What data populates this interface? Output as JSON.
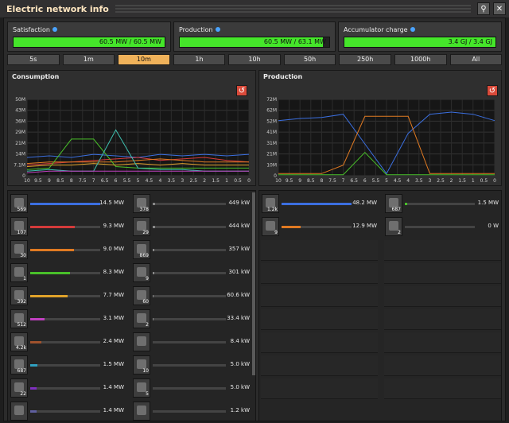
{
  "window": {
    "title": "Electric network info"
  },
  "stats": [
    {
      "label": "Satisfaction",
      "text": "60.5 MW / 60.5 MW",
      "fraction": 1.0
    },
    {
      "label": "Production",
      "text": "60.5 MW / 63.1 MW",
      "fraction": 0.96
    },
    {
      "label": "Accumulator charge",
      "text": "3.4 GJ / 3.4 GJ",
      "fraction": 1.0
    }
  ],
  "tabs": [
    "5s",
    "1m",
    "10m",
    "1h",
    "10h",
    "50h",
    "250h",
    "1000h",
    "All"
  ],
  "active_tab": "10m",
  "consumption": {
    "title": "Consumption",
    "y_ticks": [
      "50M",
      "43M",
      "36M",
      "29M",
      "21M",
      "14M",
      "7.1M",
      "0"
    ],
    "x_ticks": [
      "10",
      "9.5",
      "9",
      "8.5",
      "8",
      "7.5",
      "7",
      "6.5",
      "6",
      "5.5",
      "5",
      "4.5",
      "4",
      "3.5",
      "3",
      "2.5",
      "2",
      "1.5",
      "1",
      "0.5",
      "0"
    ]
  },
  "production": {
    "title": "Production",
    "y_ticks": [
      "72M",
      "62M",
      "52M",
      "41M",
      "31M",
      "21M",
      "10M",
      "0"
    ],
    "x_ticks": [
      "10",
      "9.5",
      "9",
      "8.5",
      "8",
      "7.5",
      "7",
      "6.5",
      "6",
      "5.5",
      "5",
      "4.5",
      "4",
      "3.5",
      "3",
      "2.5",
      "2",
      "1.5",
      "1",
      "0.5",
      "0"
    ]
  },
  "chart_data": [
    {
      "type": "line",
      "title": "Consumption",
      "ylim": [
        0,
        50
      ],
      "yunit": "MW",
      "x": [
        10,
        9,
        8,
        7,
        6,
        5,
        4,
        3,
        2,
        1,
        0
      ],
      "series": [
        {
          "color": "#3b6fe0",
          "values": [
            12,
            13,
            12,
            14,
            13,
            12,
            14,
            13,
            14,
            13,
            14
          ]
        },
        {
          "color": "#d43a3a",
          "values": [
            7,
            8,
            9,
            10,
            11,
            12,
            10,
            11,
            12,
            10,
            9
          ]
        },
        {
          "color": "#e07a22",
          "values": [
            8,
            9,
            9,
            9,
            9,
            10,
            11,
            10,
            9,
            9,
            9
          ]
        },
        {
          "color": "#49c02a",
          "values": [
            4,
            5,
            24,
            24,
            6,
            5,
            5,
            5,
            5,
            5,
            5
          ]
        },
        {
          "color": "#e0a22a",
          "values": [
            6,
            7,
            7,
            8,
            7,
            8,
            7,
            8,
            7,
            7,
            7
          ]
        },
        {
          "color": "#3fc0b0",
          "values": [
            3,
            4,
            3,
            3,
            30,
            5,
            4,
            4,
            3,
            3,
            3
          ]
        },
        {
          "color": "#c040c0",
          "values": [
            2,
            3,
            3,
            3,
            3,
            3,
            3,
            3,
            3,
            3,
            3
          ]
        }
      ]
    },
    {
      "type": "line",
      "title": "Production",
      "ylim": [
        0,
        72
      ],
      "yunit": "MW",
      "x": [
        10,
        9,
        8,
        7,
        6,
        5,
        4,
        3,
        2,
        1,
        0
      ],
      "series": [
        {
          "color": "#3b6fe0",
          "values": [
            52,
            54,
            55,
            58,
            30,
            2,
            40,
            58,
            60,
            58,
            52
          ]
        },
        {
          "color": "#e07a22",
          "values": [
            2,
            2,
            2,
            10,
            56,
            56,
            56,
            2,
            2,
            2,
            2
          ]
        },
        {
          "color": "#49c02a",
          "values": [
            1,
            1,
            1,
            1,
            22,
            1,
            1,
            1,
            1,
            1,
            1
          ]
        }
      ]
    }
  ],
  "consumers_left": [
    {
      "icon": "lab-icon",
      "count": "569",
      "value": "14.5 MW",
      "fraction": 1.0,
      "color": "#3b6fe0"
    },
    {
      "icon": "assembler-icon",
      "count": "107",
      "value": "9.3 MW",
      "fraction": 0.64,
      "color": "#d43a3a"
    },
    {
      "icon": "drill-icon",
      "count": "30",
      "value": "9.0 MW",
      "fraction": 0.62,
      "color": "#e07a22"
    },
    {
      "icon": "beacon-icon",
      "count": "1",
      "value": "8.3 MW",
      "fraction": 0.57,
      "color": "#49c02a"
    },
    {
      "icon": "furnace-icon",
      "count": "392",
      "value": "7.7 MW",
      "fraction": 0.53,
      "color": "#e0a22a"
    },
    {
      "icon": "inserter-icon",
      "count": "512",
      "value": "3.1 MW",
      "fraction": 0.21,
      "color": "#c040c0"
    },
    {
      "icon": "turret-icon",
      "count": "4.2k",
      "value": "2.4 MW",
      "fraction": 0.16,
      "color": "#a0522d"
    },
    {
      "icon": "radar-icon",
      "count": "687",
      "value": "1.5 MW",
      "fraction": 0.1,
      "color": "#30a0c0"
    },
    {
      "icon": "pump-icon",
      "count": "22",
      "value": "1.4 MW",
      "fraction": 0.09,
      "color": "#8030c0"
    },
    {
      "icon": "machine-icon",
      "count": "",
      "value": "1.4 MW",
      "fraction": 0.09,
      "color": "#6060a0"
    }
  ],
  "consumers_right": [
    {
      "icon": "centrifuge-icon",
      "count": "378",
      "value": "449 kW",
      "fraction": 0.03,
      "color": "#888888"
    },
    {
      "icon": "chemical-plant-icon",
      "count": "29",
      "value": "444 kW",
      "fraction": 0.03,
      "color": "#888888"
    },
    {
      "icon": "refinery-icon",
      "count": "869",
      "value": "357 kW",
      "fraction": 0.02,
      "color": "#888888"
    },
    {
      "icon": "rocket-silo-icon",
      "count": "9",
      "value": "301 kW",
      "fraction": 0.02,
      "color": "#888888"
    },
    {
      "icon": "splitter-icon",
      "count": "60",
      "value": "60.6 kW",
      "fraction": 0.01,
      "color": "#888888"
    },
    {
      "icon": "roboport-icon",
      "count": "2",
      "value": "33.4 kW",
      "fraction": 0.01,
      "color": "#888888"
    },
    {
      "icon": "lamp-icon",
      "count": "",
      "value": "8.4 kW",
      "fraction": 0.0,
      "color": "#888888"
    },
    {
      "icon": "filter-inserter-icon",
      "count": "10",
      "value": "5.0 kW",
      "fraction": 0.0,
      "color": "#888888"
    },
    {
      "icon": "stack-inserter-icon",
      "count": "5",
      "value": "5.0 kW",
      "fraction": 0.0,
      "color": "#888888"
    },
    {
      "icon": "burner-icon",
      "count": "",
      "value": "1.2 kW",
      "fraction": 0.0,
      "color": "#888888"
    }
  ],
  "producers_left": [
    {
      "icon": "solar-panel-icon",
      "count": "1.2k",
      "value": "48.2 MW",
      "fraction": 1.0,
      "color": "#3b6fe0"
    },
    {
      "icon": "steam-engine-icon",
      "count": "9",
      "value": "12.9 MW",
      "fraction": 0.27,
      "color": "#e07a22"
    }
  ],
  "producers_right": [
    {
      "icon": "accumulator-icon",
      "count": "687",
      "value": "1.5 MW",
      "fraction": 0.03,
      "color": "#49c02a"
    },
    {
      "icon": "turbine-icon",
      "count": "2",
      "value": "0 W",
      "fraction": 0.0,
      "color": "#888888"
    }
  ]
}
